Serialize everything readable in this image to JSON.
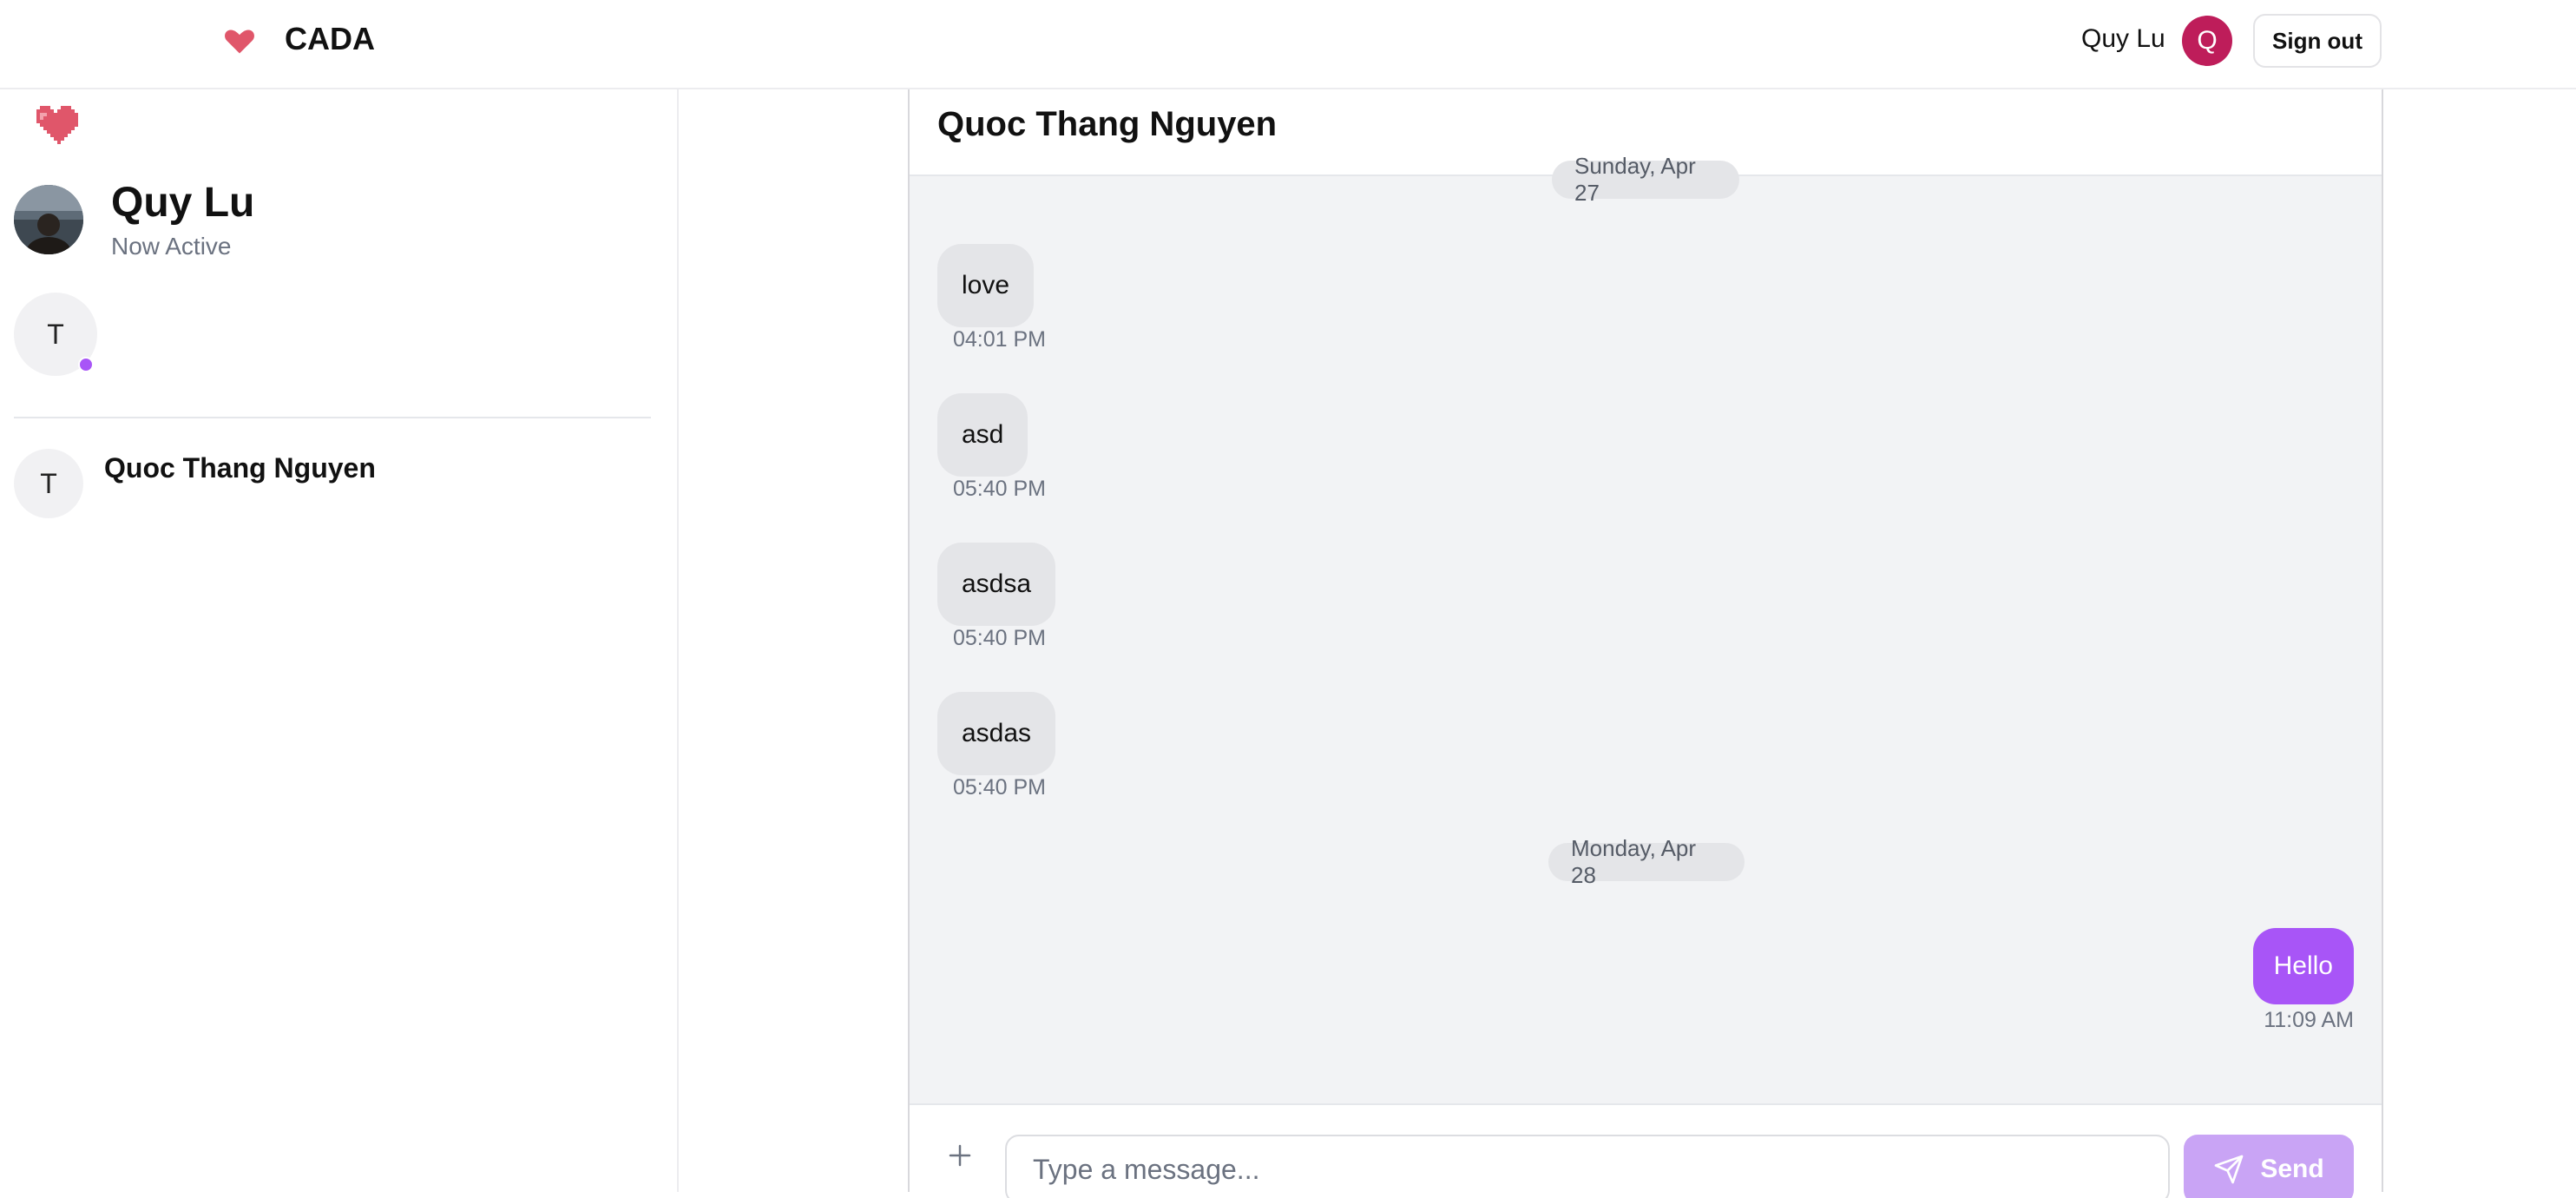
{
  "header": {
    "brand_icon": "heart-icon",
    "brand": "CADA",
    "user_name": "Quy Lu",
    "user_initial": "Q",
    "avatar_color": "#be1d5a",
    "sign_out": "Sign out"
  },
  "sidebar": {
    "logo_icon": "heart-icon",
    "profile": {
      "name": "Quy Lu",
      "status": "Now Active"
    },
    "active_users": [
      {
        "initial": "T",
        "online": true
      }
    ],
    "conversations": [
      {
        "initial": "T",
        "name": "Quoc Thang Nguyen"
      }
    ]
  },
  "chat": {
    "title": "Quoc Thang Nguyen",
    "groups": [
      {
        "date": "Sunday, Apr 27",
        "messages": [
          {
            "text": "love",
            "time": "04:01 PM",
            "from_me": false
          },
          {
            "text": "asd",
            "time": "05:40 PM",
            "from_me": false
          },
          {
            "text": "asdsa",
            "time": "05:40 PM",
            "from_me": false
          },
          {
            "text": "asdas",
            "time": "05:40 PM",
            "from_me": false
          }
        ]
      },
      {
        "date": "Monday, Apr 28",
        "messages": [
          {
            "text": "Hello",
            "time": "11:09 AM",
            "from_me": true
          }
        ]
      }
    ],
    "composer": {
      "attach_icon": "plus-icon",
      "placeholder": "Type a message...",
      "value": "",
      "send_label": "Send",
      "send_icon": "paper-plane-icon"
    }
  },
  "colors": {
    "accent": "#a855f7",
    "accent_disabled": "#c9a4f5",
    "heart": "#e0566a",
    "chat_background": "#f2f3f5",
    "incoming_bubble": "#e4e5e8"
  }
}
